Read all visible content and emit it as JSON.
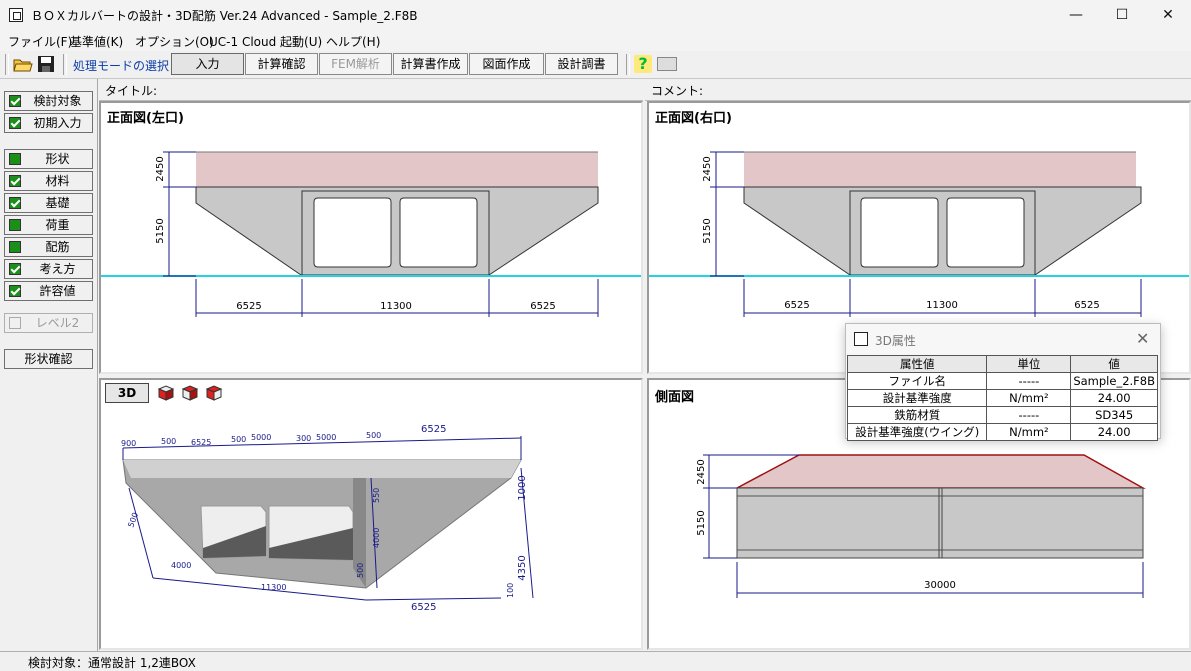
{
  "window": {
    "title": "ＢＯＸカルバートの設計・3D配筋 Ver.24 Advanced - Sample_2.F8B",
    "minimize": "—",
    "maximize": "☐",
    "close": "✕"
  },
  "menu": [
    "ファイル(F)",
    "基準値(K)",
    "オプション(O)",
    "UC-1 Cloud 起動(U)",
    "ヘルプ(H)"
  ],
  "toolbar": {
    "mode_label": "処理モードの選択",
    "buttons": [
      "入力",
      "計算確認",
      "FEM解析",
      "計算書作成",
      "図面作成",
      "設計調書"
    ],
    "active": "入力",
    "disabled": "FEM解析"
  },
  "sidebar": {
    "group1": [
      "検討対象",
      "初期入力"
    ],
    "group2": [
      "形状",
      "材料",
      "基礎",
      "荷重",
      "配筋",
      "考え方",
      "許容値"
    ],
    "level": "レベル2",
    "shape_check": "形状確認"
  },
  "header": {
    "title_label": "タイトル:",
    "comment_label": "コメント:"
  },
  "views": {
    "front_left": "正面図(左口)",
    "front_right": "正面図(右口)",
    "side": "側面図",
    "view3d_button": "3D"
  },
  "dims": {
    "h_top": "2450",
    "h_body": "5150",
    "w_side": "6525",
    "w_mid": "11300",
    "length": "30000"
  },
  "dims3d": {
    "d1": "6525",
    "d2": "500",
    "d3": "5000",
    "d4": "300",
    "d5": "5000",
    "d6": "500",
    "d7": "1000",
    "d8": "550",
    "d9": "4000",
    "d10": "4350",
    "d11": "100",
    "d12": "6525",
    "d13": "11300",
    "d14": "500",
    "d15": "4000",
    "d16": "500",
    "d17": "500",
    "d18": "900"
  },
  "dialog": {
    "title": "3D属性",
    "headers": [
      "属性値",
      "単位",
      "値"
    ],
    "rows": [
      [
        "ファイル名",
        "-----",
        "Sample_2.F8B"
      ],
      [
        "設計基準強度",
        "N/mm²",
        "24.00"
      ],
      [
        "鉄筋材質",
        "-----",
        "SD345"
      ],
      [
        "設計基準強度(ウイング)",
        "N/mm²",
        "24.00"
      ]
    ]
  },
  "status": "検討対象：通常設計 1,2連BOX",
  "colors": {
    "fill_top": "#e3c6c8",
    "concrete": "#c8c8c8",
    "ground": "#22d3e6",
    "dim": "#1a1a8a",
    "side_edge": "#a01010"
  }
}
